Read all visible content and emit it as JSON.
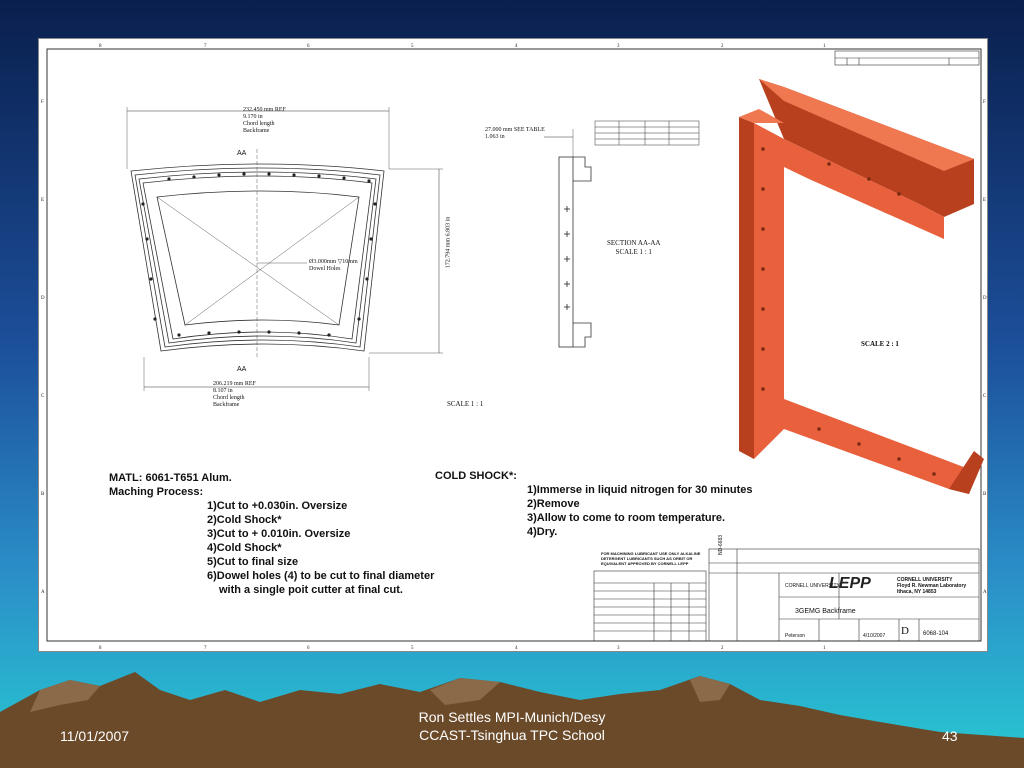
{
  "drawing": {
    "top_dim": [
      "232.450 mm REF",
      "9.170 in",
      "Chord length",
      "Backframe"
    ],
    "bottom_dim": [
      "206.219 mm REF",
      "8.107 in",
      "Chord length",
      "Backframe"
    ],
    "right_dim": [
      "172.794 mm",
      "6.803 in"
    ],
    "dowel_label": [
      "Ø3.000mm ▽10mm",
      "Dowel Holes"
    ],
    "section_mark_top": "AA",
    "section_mark_bottom": "AA",
    "section_dim": [
      "27.000 mm SEE TABLE",
      "1.063 in"
    ],
    "section_title": "SECTION  AA-AA",
    "section_scale": "SCALE 1 : 1",
    "main_scale": "SCALE 1 : 1",
    "iso_scale": "SCALE 2 : 1",
    "cornell": "CORNELL UNIVERSITY",
    "cornell_addr": [
      "Floyd R. Newman Laboratory",
      "Ithaca, NY 14853"
    ],
    "lepp_logo": "LEPP",
    "part_title": "3GEMG Backframe",
    "size": "D",
    "dwg_no": "6068-104",
    "vertical_code": "ND-6683",
    "drawn_by": "Peterson",
    "date": "4/10/2007",
    "lubricant_note": "FOR MACHINING LUBRICANT USE ONLY ALKALINE DETERGENT LUBRICANTS SUCH AS ORBIT OR EQUIVALENT APPROVED BY CORNELL LEPP"
  },
  "notes": {
    "matl": "MATL: 6061-T651 Alum.",
    "process_title": "Maching Process:",
    "steps": [
      "1)Cut to +0.030in. Oversize",
      "2)Cold Shock*",
      "3)Cut to + 0.010in. Oversize",
      "4)Cold Shock*",
      "5)Cut to final size",
      "6)Dowel holes (4) to be cut to final diameter",
      "with a single poit cutter at final cut."
    ],
    "cold_title": "COLD SHOCK*:",
    "cold_steps": [
      "1)Immerse in liquid nitrogen for 30 minutes",
      "2)Remove",
      "3)Allow to come to room temperature.",
      "4)Dry."
    ]
  },
  "footer": {
    "date": "11/01/2007",
    "author_line1": "Ron Settles  MPI-Munich/Desy",
    "author_line2": "CCAST-Tsinghua TPC School",
    "page": "43"
  },
  "colors": {
    "part": "#e8603c",
    "part_dark": "#b8401f",
    "mountain": "#6b4a2a"
  }
}
